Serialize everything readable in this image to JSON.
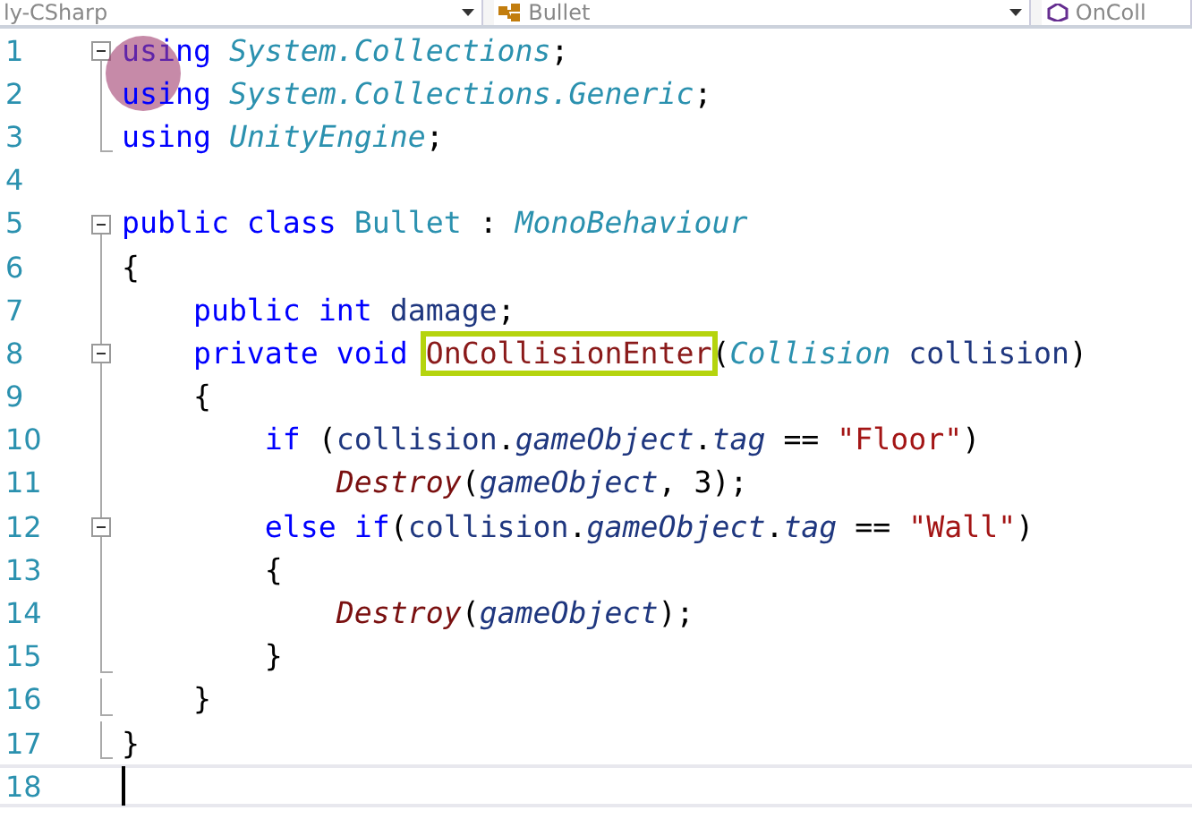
{
  "navigation_bar": [
    {
      "label": "ly-CSharp"
    },
    {
      "label": "Bullet"
    },
    {
      "label": "OnColl"
    }
  ],
  "lines": [
    {
      "number": "1",
      "expanded": true,
      "marked": true,
      "tokens": [
        {
          "text": "using ",
          "kind": "keyword"
        },
        {
          "text": "System.Collections",
          "kind": "namespace"
        },
        {
          "text": ";",
          "kind": "plain"
        }
      ],
      "children": [
        {
          "number": "2",
          "tokens": [
            {
              "text": "using ",
              "kind": "keyword"
            },
            {
              "text": "System.Collections.Generic",
              "kind": "namespace"
            },
            {
              "text": ";",
              "kind": "plain"
            }
          ]
        },
        {
          "number": "3",
          "tokens": [
            {
              "text": "using ",
              "kind": "keyword"
            },
            {
              "text": "UnityEngine",
              "kind": "namespace"
            },
            {
              "text": ";",
              "kind": "plain"
            }
          ]
        }
      ]
    },
    {
      "number": "4"
    },
    {
      "number": "5",
      "expanded": true,
      "tokens": [
        {
          "text": "public class ",
          "kind": "keyword"
        },
        {
          "text": "Bullet",
          "kind": "class"
        },
        {
          "text": " : ",
          "kind": "plain"
        },
        {
          "text": "MonoBehaviour",
          "kind": "interface"
        }
      ],
      "children": [
        {
          "number": "6",
          "tokens": [
            {
              "text": "{",
              "kind": "plain"
            }
          ]
        },
        {
          "number": "7",
          "tokens": [
            {
              "text": "    public int ",
              "kind": "keyword"
            },
            {
              "text": "damage",
              "kind": "variable"
            },
            {
              "text": ";",
              "kind": "plain"
            }
          ]
        },
        {
          "number": "8",
          "expanded": true,
          "tokens": [
            {
              "text": "    private void ",
              "kind": "keyword"
            },
            {
              "text": "OnCollisionEnter",
              "kind": "method",
              "highlighted": true
            },
            {
              "text": "(",
              "kind": "plain"
            },
            {
              "text": "Collision",
              "kind": "interface"
            },
            {
              "text": " collision",
              "kind": "variable"
            },
            {
              "text": ")",
              "kind": "plain"
            }
          ],
          "children": [
            {
              "number": "9",
              "tokens": [
                {
                  "text": "    {",
                  "kind": "plain"
                }
              ]
            },
            {
              "number": "10",
              "tokens": [
                {
                  "text": "        if",
                  "kind": "keyword"
                },
                {
                  "text": " (",
                  "kind": "plain"
                },
                {
                  "text": "collision",
                  "kind": "variable"
                },
                {
                  "text": ".",
                  "kind": "plain"
                },
                {
                  "text": "gameObject",
                  "kind": "property"
                },
                {
                  "text": ".",
                  "kind": "plain"
                },
                {
                  "text": "tag",
                  "kind": "property"
                },
                {
                  "text": " == ",
                  "kind": "plain"
                },
                {
                  "text": "\"Floor\"",
                  "kind": "string"
                },
                {
                  "text": ")",
                  "kind": "plain"
                }
              ]
            },
            {
              "number": "11",
              "tokens": [
                {
                  "text": "            Destroy",
                  "kind": "call"
                },
                {
                  "text": "(",
                  "kind": "plain"
                },
                {
                  "text": "gameObject",
                  "kind": "property"
                },
                {
                  "text": ", 3);",
                  "kind": "plain"
                }
              ]
            },
            {
              "number": "12",
              "expanded": true,
              "tokens": [
                {
                  "text": "        else if",
                  "kind": "keyword"
                },
                {
                  "text": "(",
                  "kind": "plain"
                },
                {
                  "text": "collision",
                  "kind": "variable"
                },
                {
                  "text": ".",
                  "kind": "plain"
                },
                {
                  "text": "gameObject",
                  "kind": "property"
                },
                {
                  "text": ".",
                  "kind": "plain"
                },
                {
                  "text": "tag",
                  "kind": "property"
                },
                {
                  "text": " == ",
                  "kind": "plain"
                },
                {
                  "text": "\"Wall\"",
                  "kind": "string"
                },
                {
                  "text": ")",
                  "kind": "plain"
                }
              ],
              "children": [
                {
                  "number": "13",
                  "tokens": [
                    {
                      "text": "        {",
                      "kind": "plain"
                    }
                  ]
                },
                {
                  "number": "14",
                  "tokens": [
                    {
                      "text": "            Destroy",
                      "kind": "call"
                    },
                    {
                      "text": "(",
                      "kind": "plain"
                    },
                    {
                      "text": "gameObject",
                      "kind": "property"
                    },
                    {
                      "text": ");",
                      "kind": "plain"
                    }
                  ]
                },
                {
                  "number": "15",
                  "tokens": [
                    {
                      "text": "        }",
                      "kind": "plain"
                    }
                  ]
                }
              ]
            },
            {
              "number": "16",
              "tokens": [
                {
                  "text": "    }",
                  "kind": "plain"
                }
              ]
            }
          ]
        },
        {
          "number": "17",
          "tokens": [
            {
              "text": "}",
              "kind": "plain"
            }
          ]
        }
      ]
    },
    {
      "number": "18",
      "current": true
    }
  ]
}
